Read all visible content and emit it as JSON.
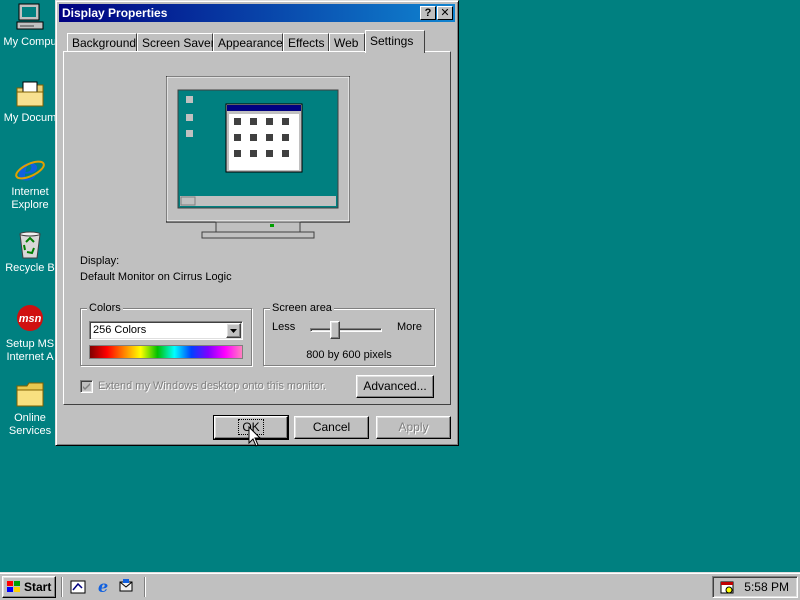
{
  "desktop": {
    "icons": [
      {
        "label_lines": [
          "My Compu"
        ],
        "icon": "my-computer-icon"
      },
      {
        "label_lines": [
          "My Docum"
        ],
        "icon": "my-documents-icon"
      },
      {
        "label_lines": [
          "Internet",
          "Explore"
        ],
        "icon": "internet-explorer-icon"
      },
      {
        "label_lines": [
          "Recycle B"
        ],
        "icon": "recycle-bin-icon"
      },
      {
        "label_lines": [
          "Setup MS",
          "Internet A"
        ],
        "icon": "msn-icon",
        "badge": "msn"
      },
      {
        "label_lines": [
          "Online",
          "Services"
        ],
        "icon": "folder-icon"
      }
    ]
  },
  "window": {
    "title": "Display Properties",
    "help_glyph": "?",
    "close_glyph": "✕",
    "tabs": [
      {
        "label": "Background",
        "active": false
      },
      {
        "label": "Screen Saver",
        "active": false
      },
      {
        "label": "Appearance",
        "active": false
      },
      {
        "label": "Effects",
        "active": false
      },
      {
        "label": "Web",
        "active": false
      },
      {
        "label": "Settings",
        "active": true
      }
    ],
    "display_label": "Display:",
    "display_value": "Default Monitor on Cirrus Logic",
    "colors": {
      "group_title": "Colors",
      "selected": "256 Colors"
    },
    "screen_area": {
      "group_title": "Screen area",
      "less": "Less",
      "more": "More",
      "value_text": "800 by 600 pixels",
      "slider_position": 0.33
    },
    "extend_checkbox_label": "Extend my Windows desktop onto this monitor.",
    "extend_checked": true,
    "advanced_label": "Advanced...",
    "ok_label": "OK",
    "cancel_label": "Cancel",
    "apply_label": "Apply"
  },
  "taskbar": {
    "start_label": "Start",
    "clock": "5:58 PM"
  },
  "colors": {
    "desktop": "#008080",
    "titlebar": "#000080",
    "face": "#c0c0c0"
  }
}
